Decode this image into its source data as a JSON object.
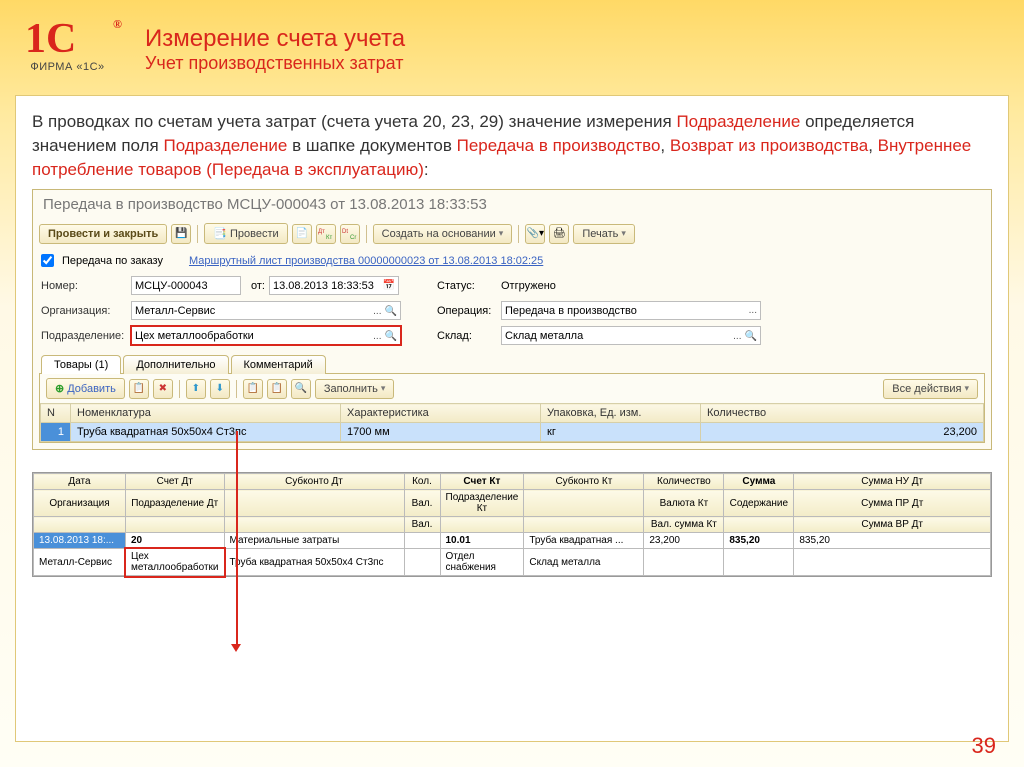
{
  "logo": {
    "brand": "1C",
    "sub": "ФИРМА «1С»"
  },
  "title": {
    "main": "Измерение счета учета",
    "sub": "Учет производственных затрат"
  },
  "intro": {
    "t1": "В проводках по счетам учета затрат (счета учета 20, 23, 29) значение измерения ",
    "h1": "Подразделение",
    "t2": " определяется значением поля ",
    "h2": "Подразделение",
    "t3": " в шапке документов ",
    "h3": "Передача в производство",
    "t4": ", ",
    "h4": "Возврат из производства",
    "t5": ", ",
    "h5": "Внутреннее потребление товаров (Передача в эксплуатацию)",
    "t6": ":"
  },
  "doc": {
    "title": "Передача в производство МСЦУ-000043 от 13.08.2013 18:33:53",
    "btn_main": "Провести и закрыть",
    "btn_provesti": "Провести",
    "btn_sozdat": "Создать на основании",
    "btn_pechat": "Печать",
    "chk_label": "Передача по заказу",
    "route_link": "Маршрутный лист производства 00000000023 от 13.08.2013 18:02:25",
    "nomer_lbl": "Номер:",
    "nomer": "МСЦУ-000043",
    "ot_lbl": "от:",
    "ot": "13.08.2013 18:33:53",
    "status_lbl": "Статус:",
    "status": "Отгружено",
    "org_lbl": "Организация:",
    "org": "Металл-Сервис",
    "oper_lbl": "Операция:",
    "oper": "Передача в производство",
    "podr_lbl": "Подразделение:",
    "podr": "Цех металлообработки",
    "sklad_lbl": "Склад:",
    "sklad": "Склад металла",
    "tabs": {
      "t1": "Товары (1)",
      "t2": "Дополнительно",
      "t3": "Комментарий"
    },
    "sub": {
      "add": "Добавить",
      "fill": "Заполнить",
      "all": "Все действия"
    },
    "cols": {
      "n": "N",
      "nom": "Номенклатура",
      "har": "Характеристика",
      "upak": "Упаковка, Ед. изм.",
      "kol": "Количество"
    },
    "row": {
      "n": "1",
      "nom": "Труба квадратная 50x50x4 Ст3пс",
      "har": "1700 мм",
      "upak": "кг",
      "kol": "23,200"
    }
  },
  "post": {
    "h": {
      "data": "Дата",
      "schdt": "Счет Дт",
      "subdt": "Субконто Дт",
      "kol": "Кол.",
      "schkt": "Счет Кт",
      "subkt": "Субконто Кт",
      "kolvo": "Количество",
      "summa": "Сумма",
      "nu": "Сумма НУ Дт",
      "org": "Организация",
      "podr": "Подразделение Дт",
      "val": "Вал.",
      "podrkt": "Подразделение Кт",
      "valkt": "Валюта Кт",
      "sod": "Содержание",
      "pr": "Сумма ПР Дт",
      "valsum": "Вал. сумма Кт",
      "vr": "Сумма ВР Дт"
    },
    "r": {
      "data": "13.08.2013 18:...",
      "schdt": "20",
      "subdt": "Материальные затраты",
      "schkt": "10.01",
      "subkt": "Труба квадратная ...",
      "kolvo": "23,200",
      "summa": "835,20",
      "nu": "835,20",
      "org": "Металл-Сервис",
      "podr": "Цех металлообработки",
      "subdt2": "Труба квадратная 50x50x4 Ст3пс",
      "podrkt": "Отдел снабжения",
      "subkt2": "Склад металла"
    }
  },
  "page": "39"
}
